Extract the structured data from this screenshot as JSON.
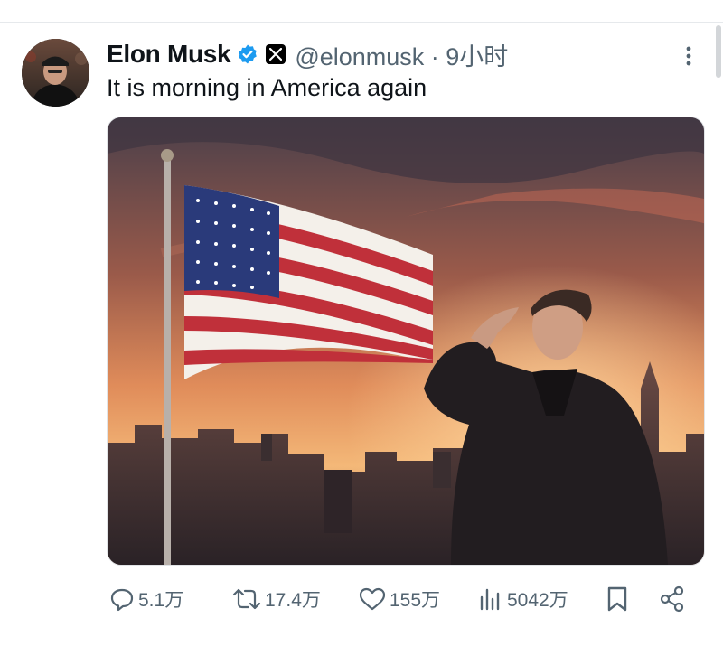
{
  "tweet": {
    "author_name": "Elon Musk",
    "handle_time": "@elonmusk · 9小时",
    "text": "It is morning in America again",
    "verified": true,
    "colors": {
      "verified_badge": "#1d9bf0",
      "text_secondary": "#536471"
    }
  },
  "media": {
    "icons": [
      "flag-image",
      "saluting-man",
      "sunset-sky",
      "city-skyline"
    ]
  },
  "actions": {
    "reply_count": "5.1万",
    "repost_count": "17.4万",
    "like_count": "155万",
    "views_count": "5042万",
    "icons": [
      "reply-icon",
      "repost-icon",
      "like-icon",
      "views-icon",
      "bookmark-icon",
      "share-icon"
    ]
  }
}
